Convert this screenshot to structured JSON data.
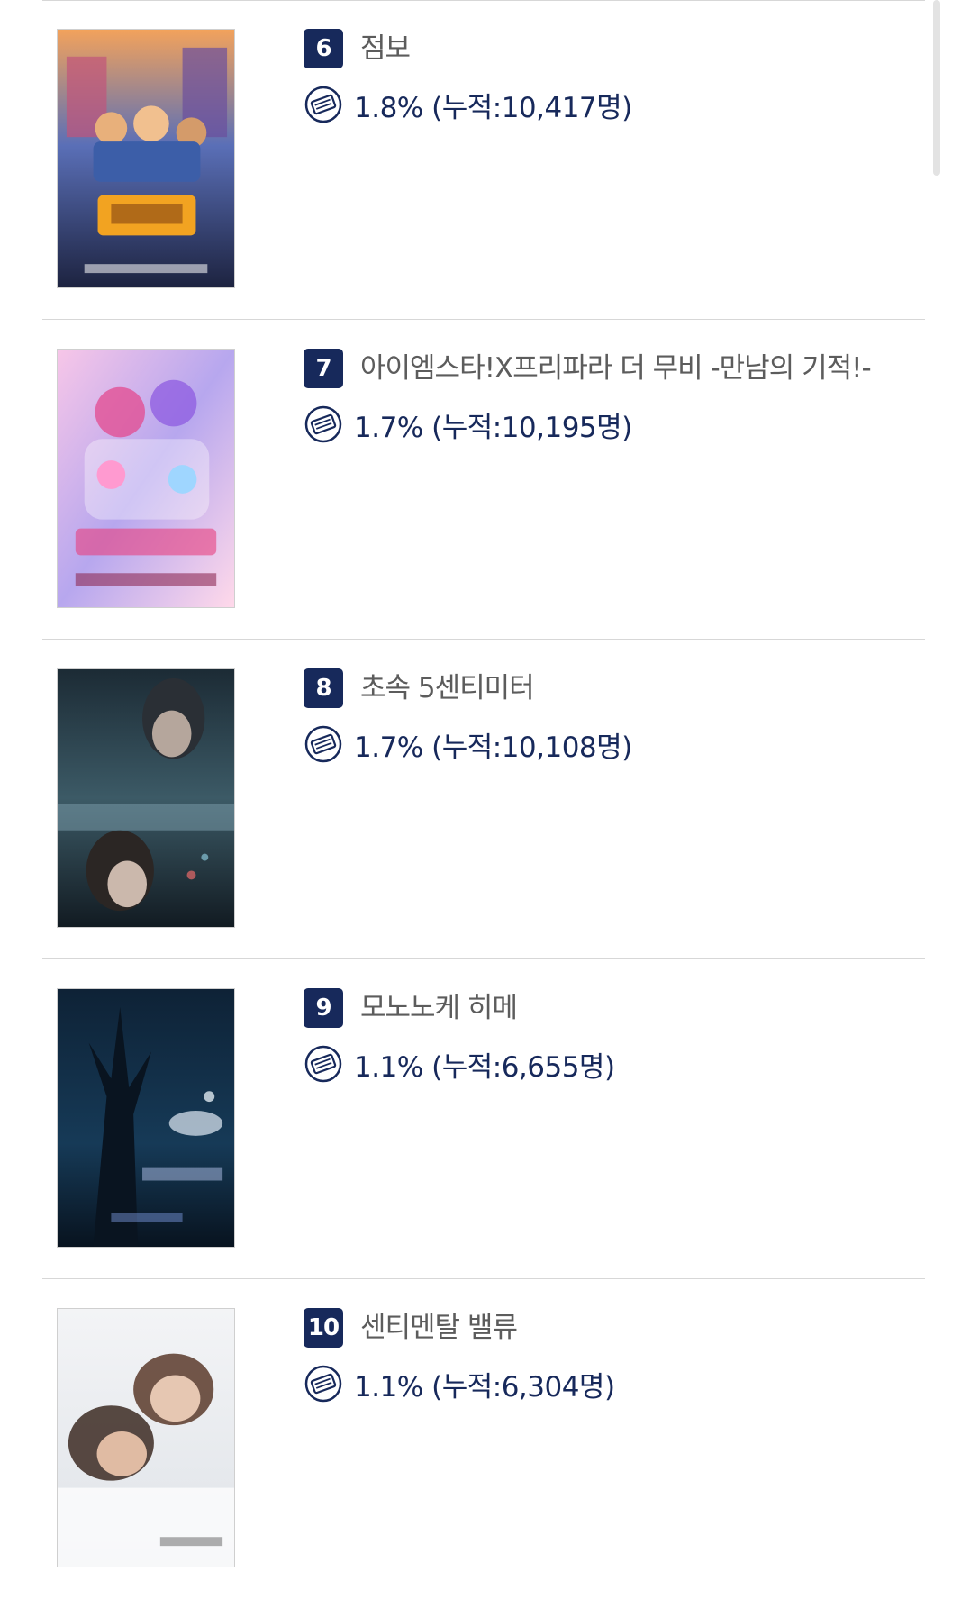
{
  "movies": [
    {
      "rank": "6",
      "title": "점보",
      "stat": "1.8% (누적:10,417명)"
    },
    {
      "rank": "7",
      "title": "아이엠스타!X프리파라 더 무비 -만남의 기적!-",
      "stat": "1.7% (누적:10,195명)"
    },
    {
      "rank": "8",
      "title": "초속 5센티미터",
      "stat": "1.7% (누적:10,108명)"
    },
    {
      "rank": "9",
      "title": "모노노케 히메",
      "stat": "1.1% (누적:6,655명)"
    },
    {
      "rank": "10",
      "title": "센티멘탈 밸류",
      "stat": "1.1% (누적:6,304명)"
    }
  ],
  "colors": {
    "rank_bg": "#17295b",
    "stat_text": "#17295b",
    "title_text": "#5c5c5c",
    "divider": "#d7d7d7"
  },
  "icons": {
    "stat": "ticket-icon"
  }
}
